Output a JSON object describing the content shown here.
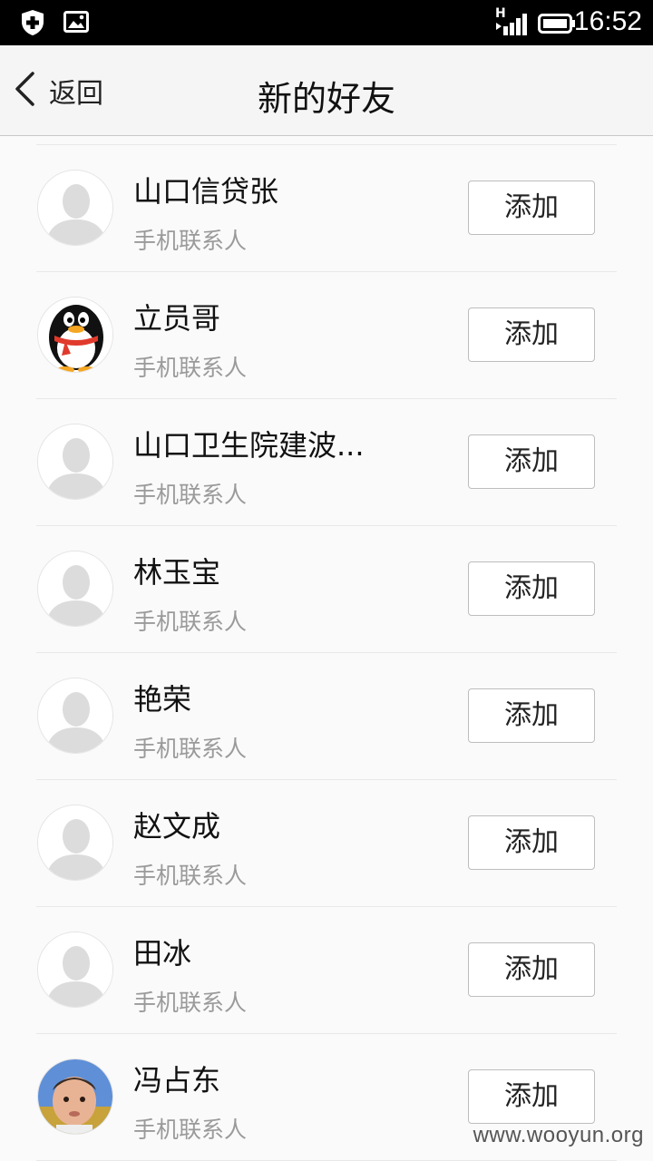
{
  "status_bar": {
    "time": "16:52",
    "network_label": "H",
    "icons": [
      "shield-plus-icon",
      "image-icon",
      "signal-icon",
      "battery-icon"
    ]
  },
  "nav": {
    "back_label": "返回",
    "title": "新的好友"
  },
  "contacts": [
    {
      "name": "山口信贷张",
      "subtitle": "手机联系人",
      "action": "添加",
      "avatar": "default"
    },
    {
      "name": "立员哥",
      "subtitle": "手机联系人",
      "action": "添加",
      "avatar": "qq-penguin"
    },
    {
      "name": " 山口卫生院建波...",
      "subtitle": "手机联系人",
      "action": "添加",
      "avatar": "default"
    },
    {
      "name": "林玉宝",
      "subtitle": "手机联系人",
      "action": "添加",
      "avatar": "default"
    },
    {
      "name": "艳荣",
      "subtitle": "手机联系人",
      "action": "添加",
      "avatar": "default"
    },
    {
      "name": "赵文成",
      "subtitle": "手机联系人",
      "action": "添加",
      "avatar": "default"
    },
    {
      "name": "田冰",
      "subtitle": "手机联系人",
      "action": "添加",
      "avatar": "default"
    },
    {
      "name": "冯占东",
      "subtitle": "手机联系人",
      "action": "添加",
      "avatar": "baby-photo"
    }
  ],
  "watermark": "www.wooyun.org"
}
